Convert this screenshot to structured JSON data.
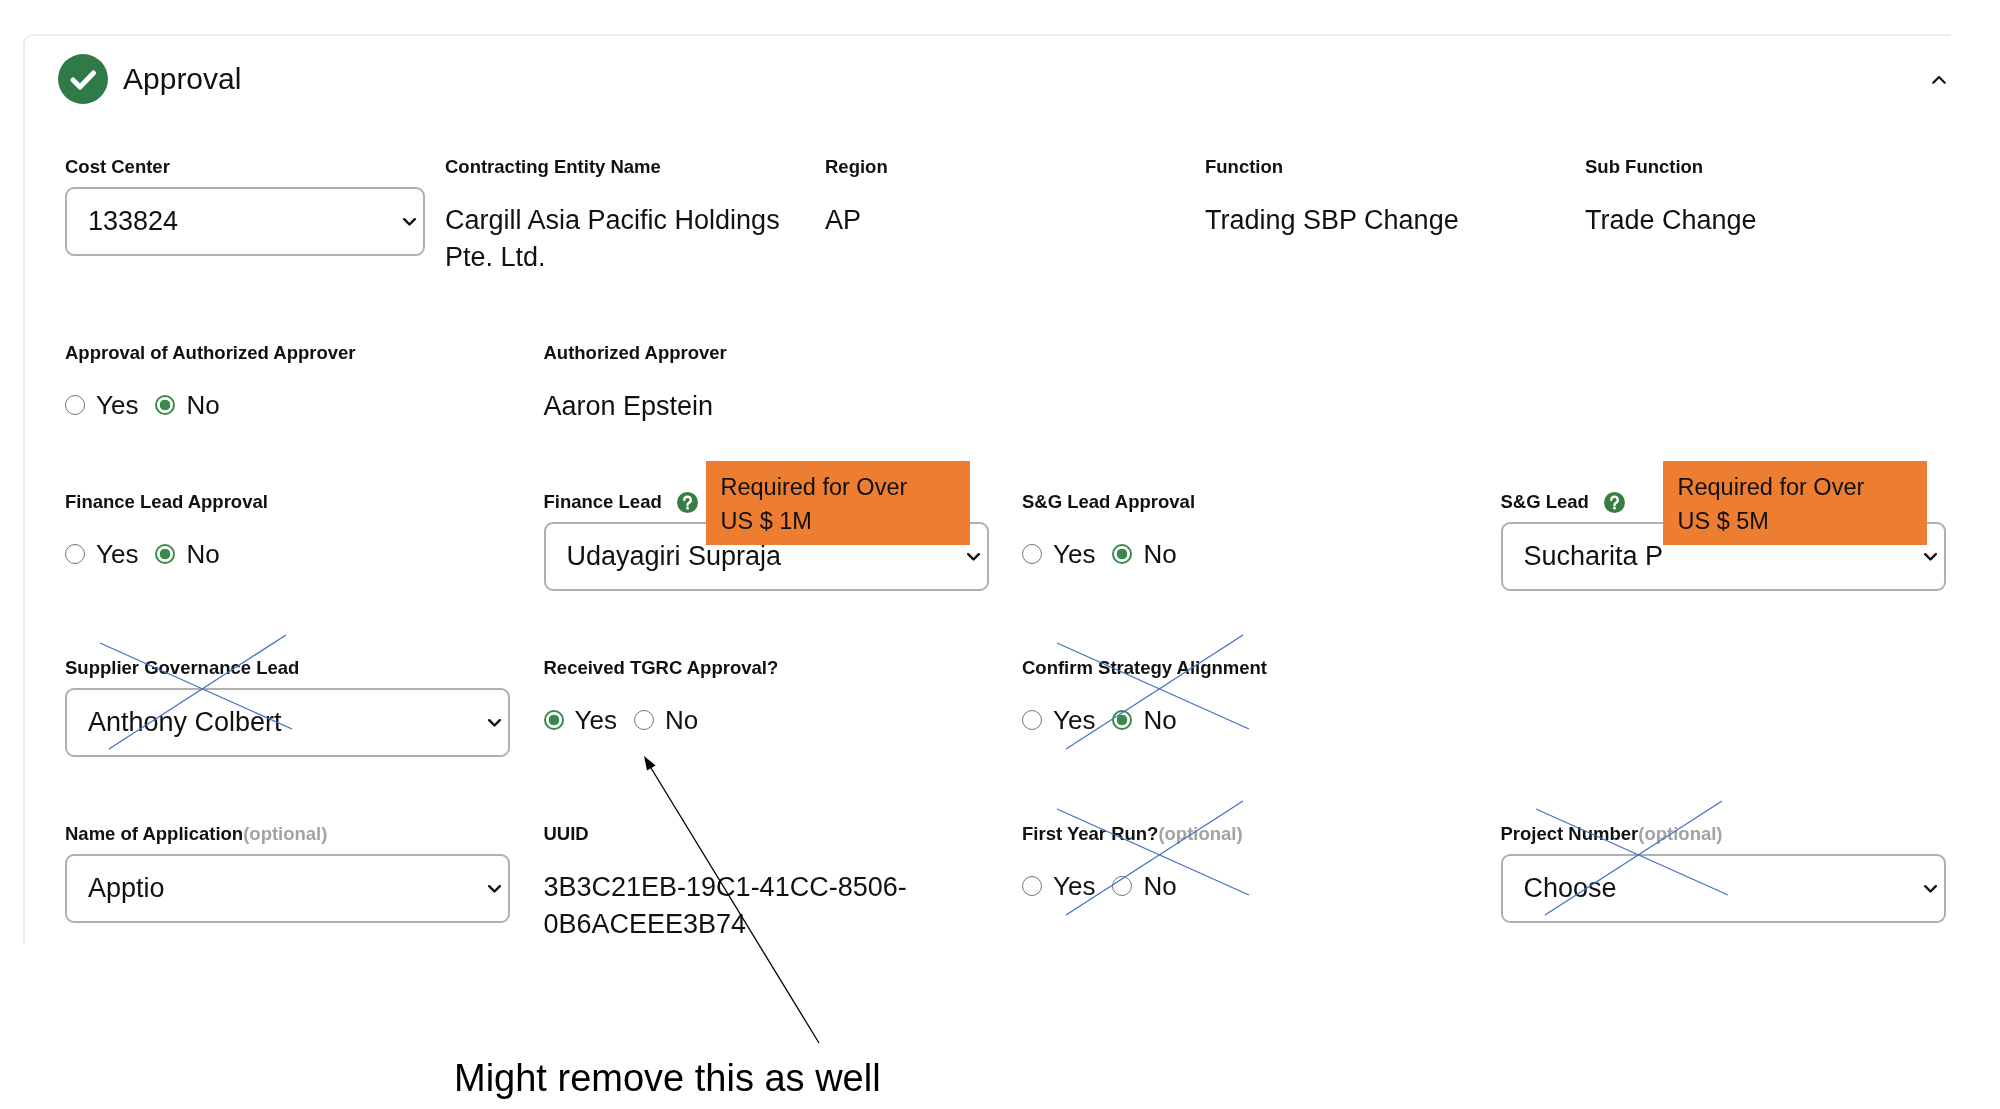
{
  "section": {
    "title": "Approval",
    "completed": true,
    "expanded": true
  },
  "summary_fields": [
    {
      "label": "Cost Center",
      "kind": "select",
      "value": "133824"
    },
    {
      "label": "Contracting Entity Name",
      "kind": "text",
      "value": "Cargill Asia Pacific Holdings Pte. Ltd."
    },
    {
      "label": "Region",
      "kind": "text",
      "value": "AP"
    },
    {
      "label": "Function",
      "kind": "text",
      "value": "Trading SBP Change"
    },
    {
      "label": "Sub Function",
      "kind": "text",
      "value": "Trade Change"
    }
  ],
  "field_rows": [
    [
      {
        "label": "Approval of Authorized Approver",
        "kind": "radio",
        "help": false,
        "crossed_out": false,
        "options": [
          {
            "label": "Yes",
            "selected": false
          },
          {
            "label": "No",
            "selected": true
          }
        ]
      },
      {
        "label": "Authorized Approver",
        "kind": "text",
        "value": "Aaron Epstein",
        "help": false,
        "crossed_out": false
      }
    ],
    [
      {
        "label": "Finance Lead Approval",
        "kind": "radio",
        "help": false,
        "crossed_out": false,
        "options": [
          {
            "label": "Yes",
            "selected": false
          },
          {
            "label": "No",
            "selected": true
          }
        ]
      },
      {
        "label": "Finance Lead",
        "kind": "select",
        "value": "Udayagiri Supraja",
        "help": true,
        "crossed_out": false,
        "callout": "Required for Over US $ 1M"
      },
      {
        "label": "S&G Lead Approval",
        "kind": "radio",
        "help": false,
        "crossed_out": false,
        "options": [
          {
            "label": "Yes",
            "selected": false
          },
          {
            "label": "No",
            "selected": true
          }
        ]
      },
      {
        "label": "S&G Lead",
        "kind": "select",
        "value": "Sucharita P",
        "help": true,
        "crossed_out": false,
        "callout": "Required for Over US $ 5M"
      }
    ],
    [
      {
        "label": "Supplier Governance Lead",
        "kind": "select",
        "value": "Anthony Colbert",
        "help": false,
        "crossed_out": true
      },
      {
        "label": "Received TGRC Approval?",
        "kind": "radio",
        "help": false,
        "crossed_out": false,
        "options": [
          {
            "label": "Yes",
            "selected": true
          },
          {
            "label": "No",
            "selected": false
          }
        ]
      },
      {
        "label": "Confirm Strategy Alignment",
        "kind": "radio",
        "help": false,
        "crossed_out": true,
        "options": [
          {
            "label": "Yes",
            "selected": false
          },
          {
            "label": "No",
            "selected": true
          }
        ]
      }
    ],
    [
      {
        "label": "Name of Application",
        "hint": "(optional)",
        "kind": "select",
        "value": "Apptio",
        "help": false,
        "crossed_out": false
      },
      {
        "label": "UUID",
        "kind": "text",
        "value": "3B3C21EB-19C1-41CC-8506-0B6ACEEE3B74",
        "help": false,
        "crossed_out": false
      },
      {
        "label": "First Year Run?",
        "hint": "(optional)",
        "kind": "radio",
        "help": false,
        "crossed_out": true,
        "options": [
          {
            "label": "Yes",
            "selected": false
          },
          {
            "label": "No",
            "selected": false
          }
        ]
      },
      {
        "label": "Project Number",
        "hint": "(optional)",
        "kind": "select",
        "placeholder": "Choose",
        "help": false,
        "crossed_out": true
      }
    ]
  ],
  "annotation": {
    "text": "Might remove this as well"
  }
}
